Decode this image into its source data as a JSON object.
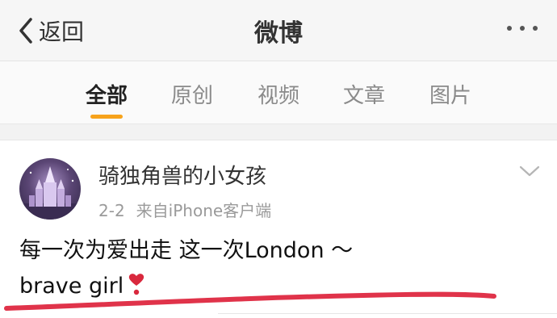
{
  "nav": {
    "back_label": "返回",
    "title": "微博",
    "back_icon": "chevron-left-icon",
    "more_icon": "more-dots-icon"
  },
  "tabs": [
    {
      "label": "全部",
      "active": true
    },
    {
      "label": "原创",
      "active": false
    },
    {
      "label": "视频",
      "active": false
    },
    {
      "label": "文章",
      "active": false
    },
    {
      "label": "图片",
      "active": false
    }
  ],
  "post": {
    "username": "骑独角兽的小女孩",
    "date": "2-2",
    "source": "来自iPhone客户端",
    "text_line1": "每一次为爱出走 这一次London ～",
    "text_line2": "brave girl",
    "emoji": "heart-exclamation-icon",
    "dropdown_icon": "chevron-down-icon"
  },
  "colors": {
    "tab_underline": "#f7a31b",
    "annotation_line": "#e0334a",
    "heart": "#d9283d"
  }
}
